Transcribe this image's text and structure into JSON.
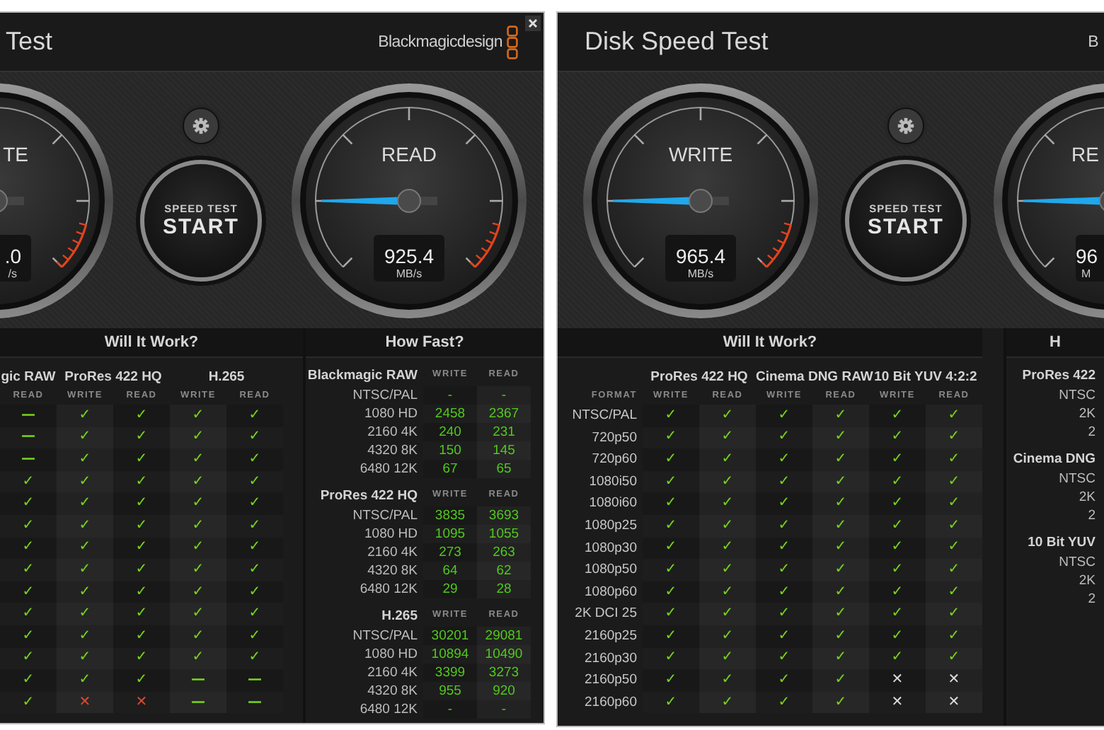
{
  "windows": [
    {
      "title": "Test",
      "logo": {
        "text": "Blackmagicdesign",
        "icon": true
      },
      "has_close": true,
      "gauges": [
        {
          "kind": "cut_left",
          "label": "TE",
          "value": ".0",
          "unit": "/s"
        },
        {
          "kind": "full",
          "label": "READ",
          "value": "925.4",
          "unit": "MB/s"
        }
      ],
      "start_button": {
        "line_1": "SPEED TEST",
        "line_2": "START"
      },
      "will_it_work": {
        "title": "Will It Work?",
        "groups": [
          {
            "label": "gic RAW",
            "columns": [
              "READ"
            ]
          },
          {
            "label": "ProRes 422 HQ",
            "columns": [
              "WRITE",
              "READ"
            ]
          },
          {
            "label": "H.265",
            "columns": [
              "WRITE",
              "READ"
            ]
          }
        ],
        "rows": [
          {
            "cells": [
              "—",
              "✓",
              "✓",
              "✓",
              "✓"
            ]
          },
          {
            "cells": [
              "—",
              "✓",
              "✓",
              "✓",
              "✓"
            ]
          },
          {
            "cells": [
              "—",
              "✓",
              "✓",
              "✓",
              "✓"
            ]
          },
          {
            "cells": [
              "✓",
              "✓",
              "✓",
              "✓",
              "✓"
            ]
          },
          {
            "cells": [
              "✓",
              "✓",
              "✓",
              "✓",
              "✓"
            ]
          },
          {
            "cells": [
              "✓",
              "✓",
              "✓",
              "✓",
              "✓"
            ]
          },
          {
            "cells": [
              "✓",
              "✓",
              "✓",
              "✓",
              "✓"
            ]
          },
          {
            "cells": [
              "✓",
              "✓",
              "✓",
              "✓",
              "✓"
            ]
          },
          {
            "cells": [
              "✓",
              "✓",
              "✓",
              "✓",
              "✓"
            ]
          },
          {
            "cells": [
              "✓",
              "✓",
              "✓",
              "✓",
              "✓"
            ]
          },
          {
            "cells": [
              "✓",
              "✓",
              "✓",
              "✓",
              "✓"
            ]
          },
          {
            "cells": [
              "✓",
              "✓",
              "✓",
              "✓",
              "✓"
            ]
          },
          {
            "cells": [
              "✓",
              "✓",
              "✓",
              "—",
              "—"
            ]
          },
          {
            "cells": [
              "✓",
              {
                "symbol": "✕",
                "color": "#e0492e"
              },
              {
                "symbol": "✕",
                "color": "#e0492e"
              },
              "—",
              "—"
            ]
          }
        ]
      },
      "how_fast": {
        "title": "How Fast?",
        "groups": [
          {
            "label": "Blackmagic RAW",
            "columns": [
              "WRITE",
              "READ"
            ],
            "rows": [
              {
                "format": "NTSC/PAL",
                "values": [
                  "-",
                  "-"
                ]
              },
              {
                "format": "1080 HD",
                "values": [
                  "2458",
                  "2367"
                ]
              },
              {
                "format": "2160 4K",
                "values": [
                  "240",
                  "231"
                ]
              },
              {
                "format": "4320 8K",
                "values": [
                  "150",
                  "145"
                ]
              },
              {
                "format": "6480 12K",
                "values": [
                  "67",
                  "65"
                ]
              }
            ]
          },
          {
            "label": "ProRes 422 HQ",
            "columns": [
              "WRITE",
              "READ"
            ],
            "rows": [
              {
                "format": "NTSC/PAL",
                "values": [
                  "3835",
                  "3693"
                ]
              },
              {
                "format": "1080 HD",
                "values": [
                  "1095",
                  "1055"
                ]
              },
              {
                "format": "2160 4K",
                "values": [
                  "273",
                  "263"
                ]
              },
              {
                "format": "4320 8K",
                "values": [
                  "64",
                  "62"
                ]
              },
              {
                "format": "6480 12K",
                "values": [
                  "29",
                  "28"
                ]
              }
            ]
          },
          {
            "label": "H.265",
            "columns": [
              "WRITE",
              "READ"
            ],
            "rows": [
              {
                "format": "NTSC/PAL",
                "values": [
                  "30201",
                  "29081"
                ]
              },
              {
                "format": "1080 HD",
                "values": [
                  "10894",
                  "10490"
                ]
              },
              {
                "format": "2160 4K",
                "values": [
                  "3399",
                  "3273"
                ]
              },
              {
                "format": "4320 8K",
                "values": [
                  "955",
                  "920"
                ]
              },
              {
                "format": "6480 12K",
                "values": [
                  "-",
                  "-"
                ]
              }
            ]
          }
        ]
      }
    },
    {
      "title": "Disk Speed Test",
      "logo": {
        "text": "B",
        "icon": false
      },
      "has_close": false,
      "gauges": [
        {
          "kind": "full",
          "label": "WRITE",
          "value": "965.4",
          "unit": "MB/s"
        },
        {
          "kind": "cut_right",
          "label": "RE",
          "value": "96",
          "unit": "M"
        }
      ],
      "start_button": {
        "line_1": "SPEED TEST",
        "line_2": "START"
      },
      "will_it_work": {
        "title": "Will It Work?",
        "format_header": "FORMAT",
        "groups": [
          {
            "label": "ProRes 422 HQ",
            "columns": [
              "WRITE",
              "READ"
            ]
          },
          {
            "label": "Cinema DNG RAW",
            "columns": [
              "WRITE",
              "READ"
            ]
          },
          {
            "label": "10 Bit YUV 4:2:2",
            "columns": [
              "WRITE",
              "READ"
            ]
          }
        ],
        "rows": [
          {
            "format": "NTSC/PAL",
            "cells": [
              "✓",
              "✓",
              "✓",
              "✓",
              "✓",
              "✓"
            ]
          },
          {
            "format": "720p50",
            "cells": [
              "✓",
              "✓",
              "✓",
              "✓",
              "✓",
              "✓"
            ]
          },
          {
            "format": "720p60",
            "cells": [
              "✓",
              "✓",
              "✓",
              "✓",
              "✓",
              "✓"
            ]
          },
          {
            "format": "1080i50",
            "cells": [
              "✓",
              "✓",
              "✓",
              "✓",
              "✓",
              "✓"
            ]
          },
          {
            "format": "1080i60",
            "cells": [
              "✓",
              "✓",
              "✓",
              "✓",
              "✓",
              "✓"
            ]
          },
          {
            "format": "1080p25",
            "cells": [
              "✓",
              "✓",
              "✓",
              "✓",
              "✓",
              "✓"
            ]
          },
          {
            "format": "1080p30",
            "cells": [
              "✓",
              "✓",
              "✓",
              "✓",
              "✓",
              "✓"
            ]
          },
          {
            "format": "1080p50",
            "cells": [
              "✓",
              "✓",
              "✓",
              "✓",
              "✓",
              "✓"
            ]
          },
          {
            "format": "1080p60",
            "cells": [
              "✓",
              "✓",
              "✓",
              "✓",
              "✓",
              "✓"
            ]
          },
          {
            "format": "2K DCI 25",
            "cells": [
              "✓",
              "✓",
              "✓",
              "✓",
              "✓",
              "✓"
            ]
          },
          {
            "format": "2160p25",
            "cells": [
              "✓",
              "✓",
              "✓",
              "✓",
              "✓",
              "✓"
            ]
          },
          {
            "format": "2160p30",
            "cells": [
              "✓",
              "✓",
              "✓",
              "✓",
              "✓",
              "✓"
            ]
          },
          {
            "format": "2160p50",
            "cells": [
              "✓",
              "✓",
              "✓",
              "✓",
              {
                "symbol": "✕",
                "color": "#dcdcdc"
              },
              {
                "symbol": "✕",
                "color": "#dcdcdc"
              }
            ]
          },
          {
            "format": "2160p60",
            "cells": [
              "✓",
              "✓",
              "✓",
              "✓",
              {
                "symbol": "✕",
                "color": "#dcdcdc"
              },
              {
                "symbol": "✕",
                "color": "#dcdcdc"
              }
            ]
          }
        ]
      },
      "how_fast": {
        "title": "H",
        "groups": [
          {
            "label": "ProRes 422",
            "rows": [
              {
                "format": "NTSC"
              },
              {
                "format": "2K"
              },
              {
                "format": "2"
              }
            ]
          },
          {
            "label": "Cinema DNG",
            "rows": [
              {
                "format": "NTSC"
              },
              {
                "format": "2K"
              },
              {
                "format": "2"
              }
            ]
          },
          {
            "label": "10 Bit YUV",
            "rows": [
              {
                "format": "NTSC"
              },
              {
                "format": "2K"
              },
              {
                "format": "2"
              }
            ]
          }
        ]
      }
    }
  ]
}
